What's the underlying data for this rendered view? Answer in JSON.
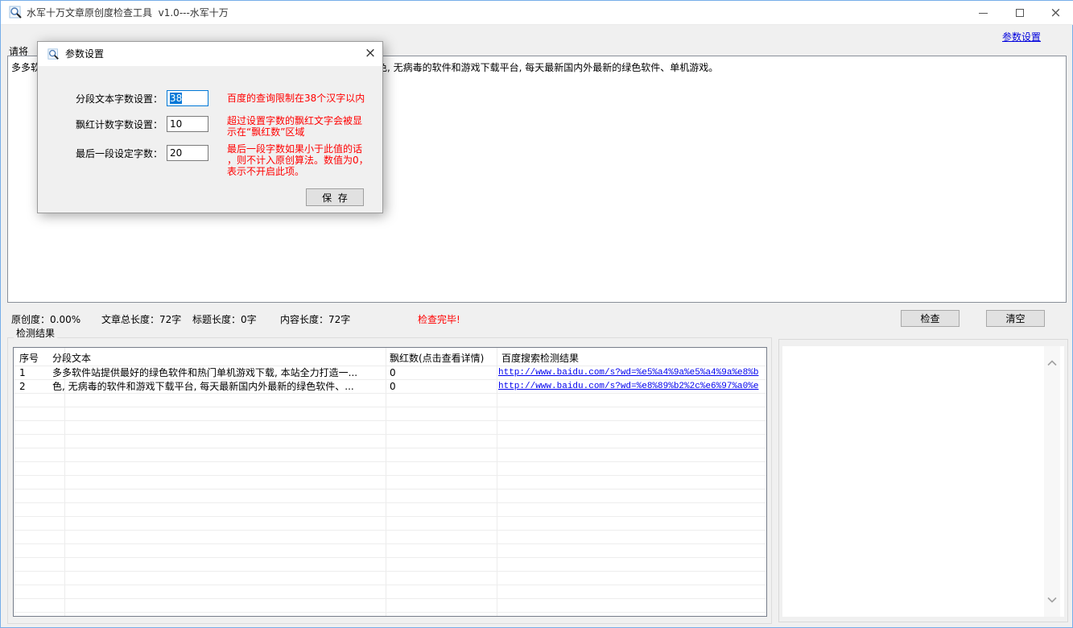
{
  "window": {
    "title": "水军十万文章原创度检查工具  v1.0---水军十万"
  },
  "toolbar": {
    "settings_link": "参数设置"
  },
  "editor": {
    "label": "请将",
    "line1_left": "多多软",
    "line1_right": "色, 无病毒的软件和游戏下载平台, 每天最新国内外最新的绿色软件、单机游戏。"
  },
  "dialog": {
    "title": "参数设置",
    "close_glyph": "×",
    "fields": [
      {
        "label": "分段文本字数设置：",
        "value": "38",
        "hint": "百度的查询限制在38个汉字以内"
      },
      {
        "label": "飘红计数字数设置：",
        "value": "10",
        "hint": "超过设置字数的飘红文字会被显示在“飘红数”区域"
      },
      {
        "label": "最后一段设定字数：",
        "value": "20",
        "hint": "最后一段字数如果小于此值的话，则不计入原创算法。数值为0，表示不开启此项。"
      }
    ],
    "save_button": "保  存"
  },
  "status": {
    "originality": "原创度：0.00%",
    "total_length": "文章总长度：72字",
    "title_length": "标题长度：0字",
    "content_length": "内容长度：72字",
    "check_done": "检查完毕!"
  },
  "actions": {
    "check": "检查",
    "clear": "清空"
  },
  "results": {
    "group_label": "检测结果",
    "table": {
      "headers": [
        "序号",
        "分段文本",
        "飘红数(点击查看详情)",
        "百度搜索检测结果"
      ],
      "rows": [
        {
          "no": "1",
          "text": "多多软件站提供最好的绿色软件和热门单机游戏下载, 本站全力打造一...",
          "red_count": "0",
          "url": "http://www.baidu.com/s?wd=%e5%a4%9a%e5%a4%9a%e8%b"
        },
        {
          "no": "2",
          "text": "色, 无病毒的软件和游戏下载平台, 每天最新国内外最新的绿色软件、...",
          "red_count": "0",
          "url": "http://www.baidu.com/s?wd=%e8%89%b2%2c%e6%97%a0%e"
        }
      ]
    }
  },
  "colors": {
    "accent": "#0078d7",
    "hint_red": "#ff0000",
    "link_blue": "#0000dd",
    "status_red": "#ff0000"
  }
}
